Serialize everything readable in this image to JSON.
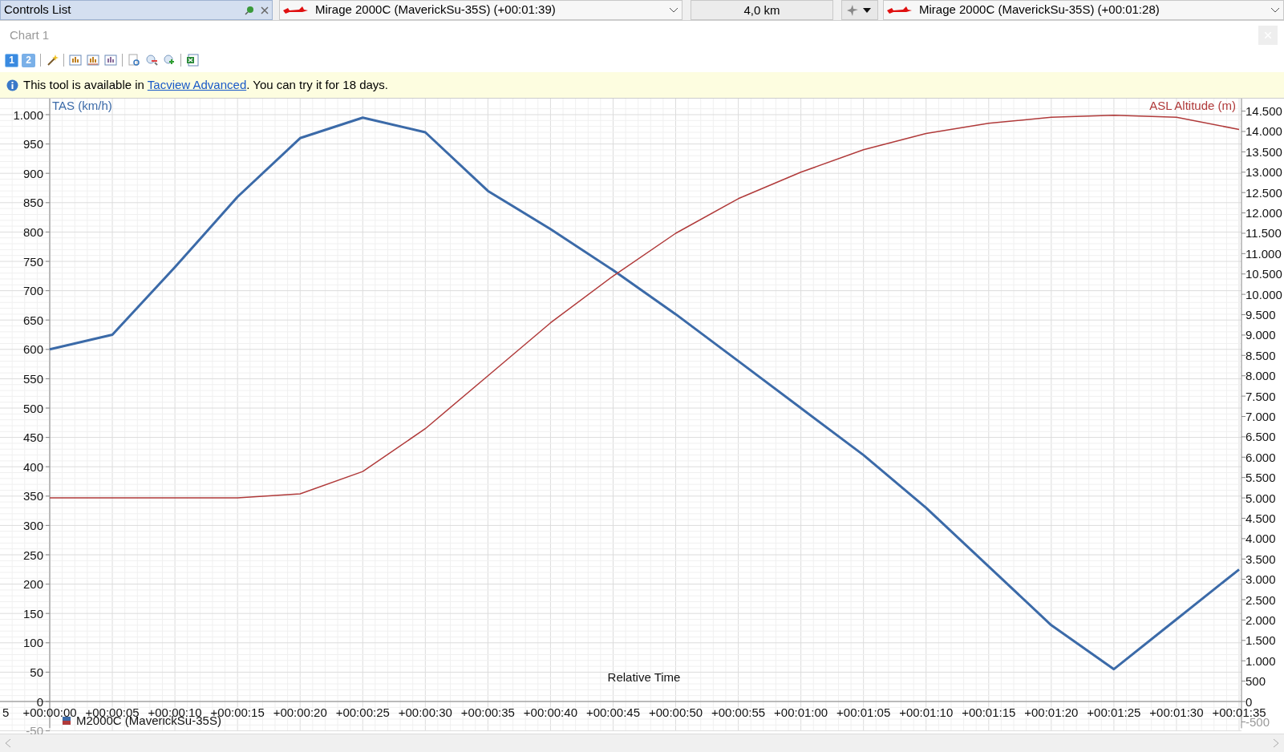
{
  "top_bar": {
    "panel_title": "Controls List",
    "left_target": "Mirage 2000C (MaverickSu-35S) (+00:01:39)",
    "range": "4,0 km",
    "right_target": "Mirage 2000C (MaverickSu-35S) (+00:01:28)"
  },
  "chart_tab": {
    "title": "Chart 1"
  },
  "toolbar": {
    "layers": [
      {
        "label": "1",
        "selected": true
      },
      {
        "label": "2",
        "selected": false
      }
    ]
  },
  "info_bar": {
    "text_before": "This tool is available in ",
    "link": "Tacview Advanced",
    "text_after": ". You can try it for 18 days."
  },
  "chart": {
    "clipped_x_label": "5",
    "chart_data": {
      "type": "line",
      "xlabel": "Relative Time",
      "grid": true,
      "categories": [
        "+00:00:00",
        "+00:00:05",
        "+00:00:10",
        "+00:00:15",
        "+00:00:20",
        "+00:00:25",
        "+00:00:30",
        "+00:00:35",
        "+00:00:40",
        "+00:00:45",
        "+00:00:50",
        "+00:00:55",
        "+00:01:00",
        "+00:01:05",
        "+00:01:10",
        "+00:01:15",
        "+00:01:20",
        "+00:01:25",
        "+00:01:30",
        "+00:01:35"
      ],
      "series": [
        {
          "name": "TAS (km/h)",
          "color": "#3b6aa8",
          "axis": "y",
          "values": [
            600,
            625,
            740,
            860,
            960,
            995,
            970,
            870,
            805,
            735,
            660,
            580,
            500,
            420,
            330,
            230,
            130,
            55,
            140,
            225
          ]
        },
        {
          "name": "ASL Altitude (m)",
          "color": "#b03a3a",
          "axis": "y2",
          "values": [
            5000,
            5000,
            5000,
            5000,
            5100,
            5650,
            6700,
            8000,
            9300,
            10450,
            11500,
            12350,
            13000,
            13550,
            13950,
            14200,
            14350,
            14400,
            14350,
            14050
          ]
        }
      ],
      "ylim": [
        -50,
        1000
      ],
      "y2lim": [
        -500,
        14500
      ],
      "yticks": [
        -50,
        0,
        50,
        100,
        150,
        200,
        250,
        300,
        350,
        400,
        450,
        500,
        550,
        600,
        650,
        700,
        750,
        800,
        850,
        900,
        950,
        {
          "value": 1000,
          "label": "1.000"
        }
      ],
      "y2ticks": [
        {
          "value": -500,
          "label": "-500"
        },
        {
          "value": 0,
          "label": "0"
        },
        {
          "value": 500,
          "label": "500"
        },
        {
          "value": 1000,
          "label": "1.000"
        },
        {
          "value": 1500,
          "label": "1.500"
        },
        {
          "value": 2000,
          "label": "2.000"
        },
        {
          "value": 2500,
          "label": "2.500"
        },
        {
          "value": 3000,
          "label": "3.000"
        },
        {
          "value": 3500,
          "label": "3.500"
        },
        {
          "value": 4000,
          "label": "4.000"
        },
        {
          "value": 4500,
          "label": "4.500"
        },
        {
          "value": 5000,
          "label": "5.000"
        },
        {
          "value": 5500,
          "label": "5.500"
        },
        {
          "value": 6000,
          "label": "6.000"
        },
        {
          "value": 6500,
          "label": "6.500"
        },
        {
          "value": 7000,
          "label": "7.000"
        },
        {
          "value": 7500,
          "label": "7.500"
        },
        {
          "value": 8000,
          "label": "8.000"
        },
        {
          "value": 8500,
          "label": "8.500"
        },
        {
          "value": 9000,
          "label": "9.000"
        },
        {
          "value": 9500,
          "label": "9.500"
        },
        {
          "value": 10000,
          "label": "10.000"
        },
        {
          "value": 10500,
          "label": "10.500"
        },
        {
          "value": 11000,
          "label": "11.000"
        },
        {
          "value": 11500,
          "label": "11.500"
        },
        {
          "value": 12000,
          "label": "12.000"
        },
        {
          "value": 12500,
          "label": "12.500"
        },
        {
          "value": 13000,
          "label": "13.000"
        },
        {
          "value": 13500,
          "label": "13.500"
        },
        {
          "value": 14000,
          "label": "14.000"
        },
        {
          "value": 14500,
          "label": "14.500"
        }
      ]
    },
    "legend": {
      "label": "M2000C (MaverickSu-35S)"
    }
  }
}
